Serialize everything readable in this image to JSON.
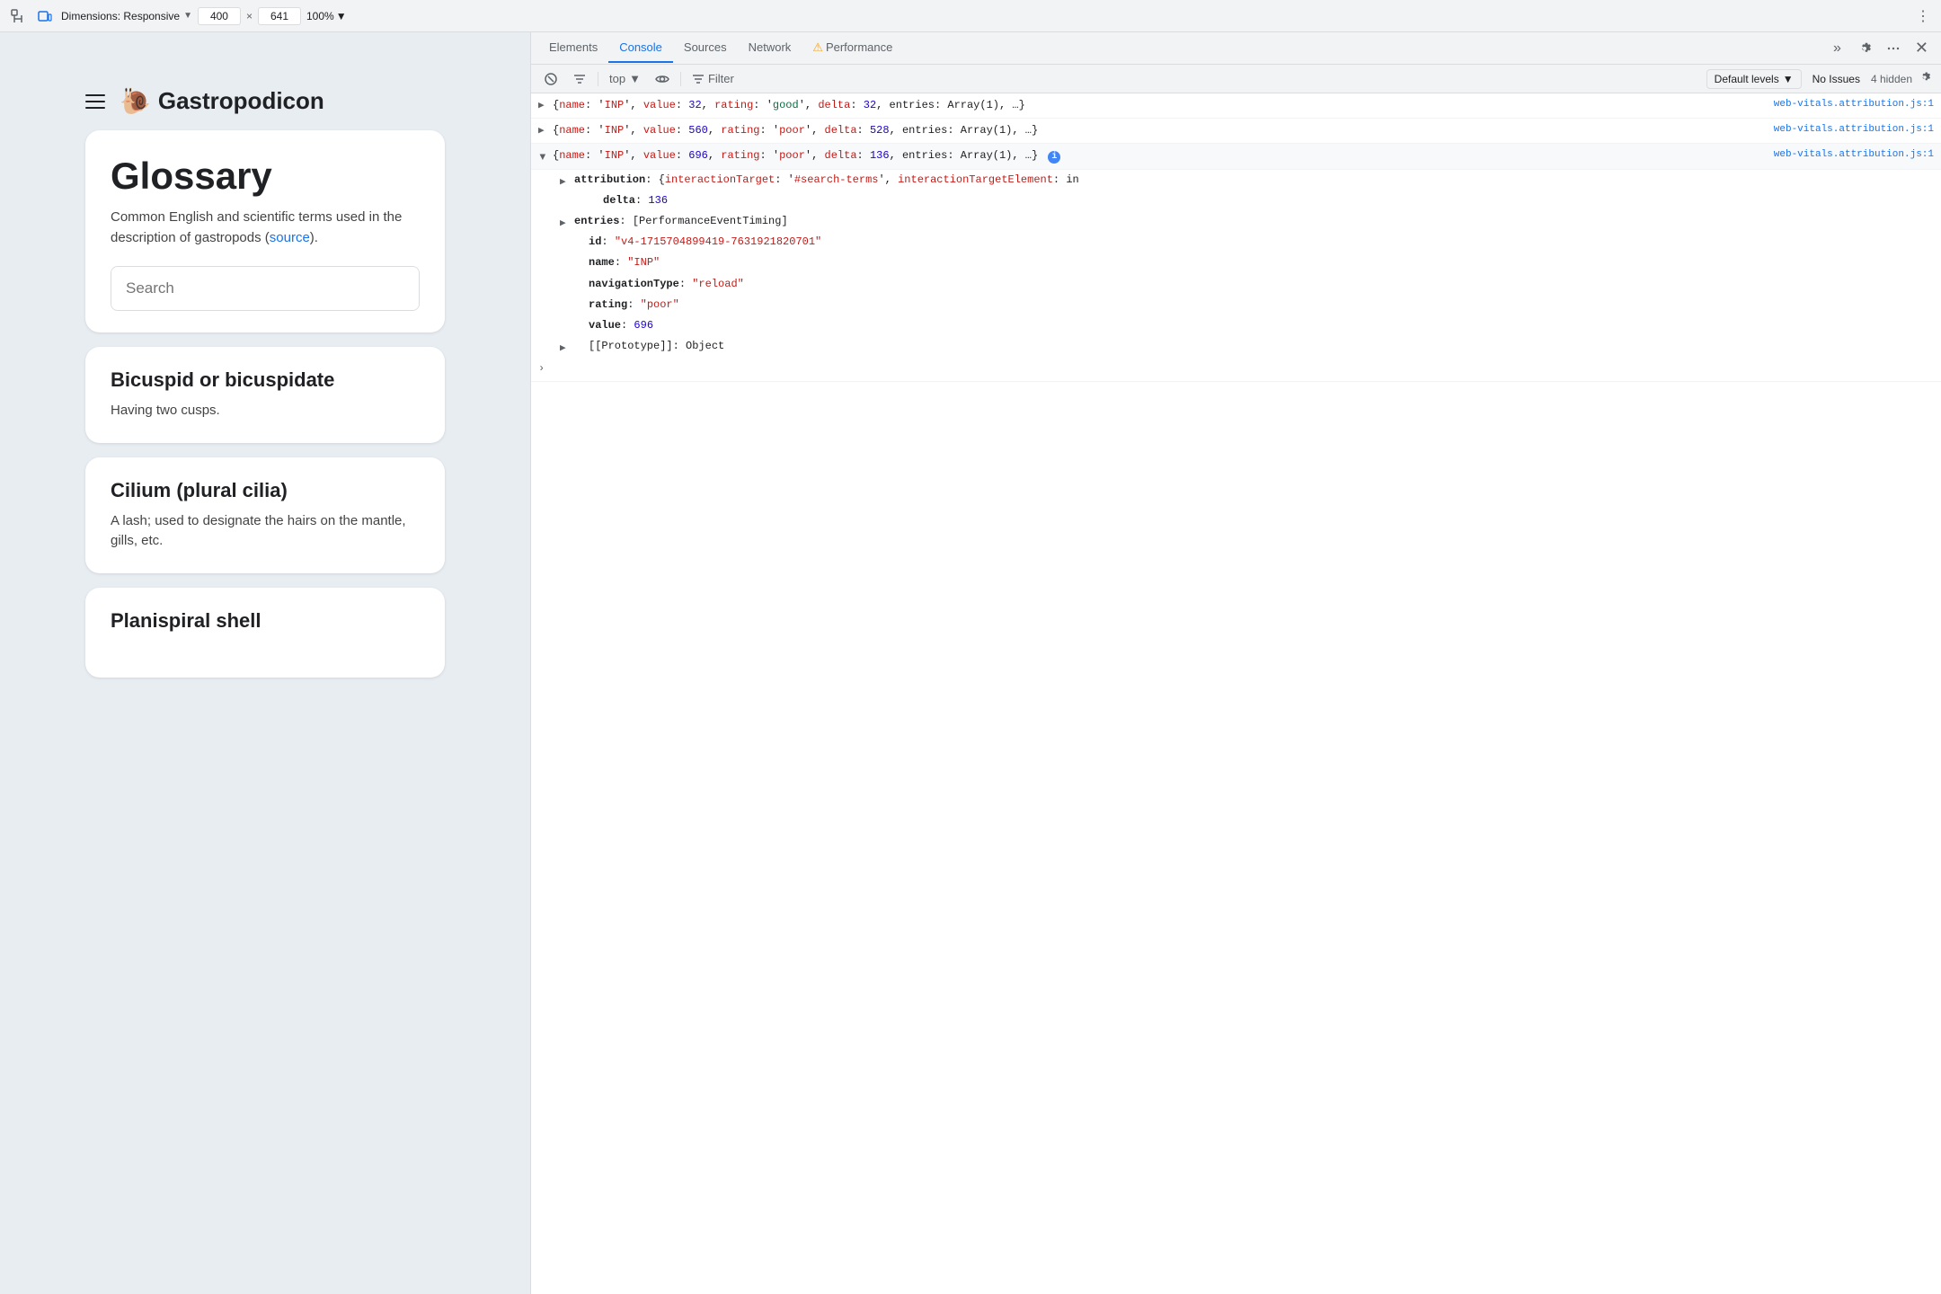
{
  "topbar": {
    "dimensions_label": "Dimensions: Responsive",
    "dimensions_chevron": "▼",
    "width_value": "400",
    "close_char": "×",
    "height_value": "641",
    "zoom_label": "100%",
    "zoom_chevron": "▼",
    "more_icon": "⋮"
  },
  "browser": {
    "site_name": "Gastropodicon",
    "glossary_title": "Glossary",
    "glossary_desc_before": "Common English and scientific terms used in the description of gastropods (",
    "glossary_desc_link": "source",
    "glossary_desc_after": ").",
    "search_placeholder": "Search",
    "terms": [
      {
        "title": "Bicuspid or bicuspidate",
        "desc": "Having two cusps."
      },
      {
        "title": "Cilium (plural cilia)",
        "desc": "A lash; used to designate the hairs on the mantle, gills, etc."
      },
      {
        "title": "Planispiral shell",
        "desc": ""
      }
    ]
  },
  "devtools": {
    "tabs": [
      {
        "id": "elements",
        "label": "Elements",
        "active": false
      },
      {
        "id": "console",
        "label": "Console",
        "active": true
      },
      {
        "id": "sources",
        "label": "Sources",
        "active": false
      },
      {
        "id": "network",
        "label": "Network",
        "active": false
      },
      {
        "id": "performance",
        "label": "Performance",
        "active": false
      }
    ],
    "subtoolbar": {
      "top_label": "top",
      "top_chevron": "▼",
      "filter_label": "Filter",
      "levels_label": "Default levels",
      "levels_chevron": "▼",
      "no_issues": "No Issues",
      "hidden_count": "4 hidden"
    },
    "console_entries": [
      {
        "id": "entry1",
        "collapsed": true,
        "link": "web-vitals.attribution.js:1",
        "content": "{name: 'INP', value: 32, rating: 'good', delta: 32, entries: Array(1), …}",
        "content_parts": [
          {
            "text": "{",
            "class": ""
          },
          {
            "text": "name",
            "class": "c-str-key"
          },
          {
            "text": ": '",
            "class": ""
          },
          {
            "text": "INP",
            "class": "c-str"
          },
          {
            "text": "', ",
            "class": ""
          },
          {
            "text": "value",
            "class": "c-str-key"
          },
          {
            "text": ": ",
            "class": ""
          },
          {
            "text": "32",
            "class": "c-num"
          },
          {
            "text": ", ",
            "class": ""
          },
          {
            "text": "rating",
            "class": "c-str-key"
          },
          {
            "text": ": '",
            "class": ""
          },
          {
            "text": "good",
            "class": "c-rating-good"
          },
          {
            "text": "', ",
            "class": ""
          },
          {
            "text": "delta",
            "class": "c-str-key"
          },
          {
            "text": ": ",
            "class": ""
          },
          {
            "text": "32",
            "class": "c-num"
          },
          {
            "text": ", entries: Array(1), …}",
            "class": ""
          }
        ]
      },
      {
        "id": "entry2",
        "collapsed": true,
        "link": "web-vitals.attribution.js:1",
        "content": "{name: 'INP', value: 560, rating: 'poor', delta: 528, entries: Array(1), …}",
        "content_parts": [
          {
            "text": "{",
            "class": ""
          },
          {
            "text": "name",
            "class": "c-str-key"
          },
          {
            "text": ": '",
            "class": ""
          },
          {
            "text": "INP",
            "class": "c-str"
          },
          {
            "text": "', ",
            "class": ""
          },
          {
            "text": "value",
            "class": "c-str-key"
          },
          {
            "text": ": ",
            "class": ""
          },
          {
            "text": "560",
            "class": "c-num"
          },
          {
            "text": ", ",
            "class": ""
          },
          {
            "text": "rating",
            "class": "c-str-key"
          },
          {
            "text": ": '",
            "class": ""
          },
          {
            "text": "poor",
            "class": "c-rating-poor"
          },
          {
            "text": "', ",
            "class": ""
          },
          {
            "text": "delta",
            "class": "c-str-key"
          },
          {
            "text": ": ",
            "class": ""
          },
          {
            "text": "528",
            "class": "c-num"
          },
          {
            "text": ", entries: Array(1), …}",
            "class": ""
          }
        ]
      },
      {
        "id": "entry3",
        "collapsed": false,
        "link": "web-vitals.attribution.js:1",
        "content_main": "{name: 'INP', value: 696, rating: 'poor', delta: 136, entries: Array(1), …}",
        "sub_entries": [
          {
            "type": "attribution",
            "key": "attribution",
            "value": "{interactionTarget: '#search-terms', interactionTargetElement: in",
            "arrow": true
          },
          {
            "type": "delta_plain",
            "key": "delta",
            "value": "136"
          },
          {
            "type": "entries",
            "key": "entries",
            "value": "[PerformanceEventTiming]",
            "arrow": true
          }
        ],
        "deep_entries": [
          {
            "key": "id",
            "value": "\"v4-1715704899419-7631921820701\""
          },
          {
            "key": "name",
            "value": "\"INP\""
          },
          {
            "key": "navigationType",
            "value": "\"reload\""
          },
          {
            "key": "rating",
            "value": "\"poor\""
          },
          {
            "key": "value",
            "value": "696"
          }
        ],
        "prototype_entry": "[[Prototype]]: Object"
      }
    ]
  }
}
